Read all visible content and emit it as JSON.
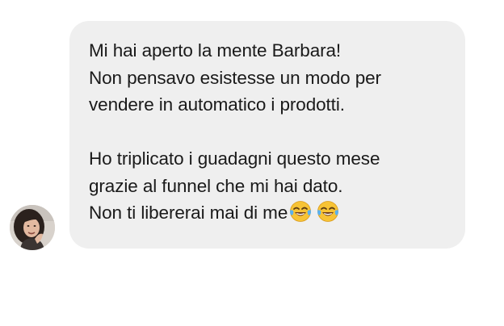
{
  "message": {
    "lines": [
      "Mi hai aperto la mente Barbara!",
      "Non pensavo esistesse un modo per",
      "vendere in automatico i prodotti.",
      "",
      "Ho triplicato i guadagni questo mese",
      "grazie al funnel che mi hai dato.",
      "Non ti libererai mai di me"
    ],
    "emojis": [
      "face-with-tears-of-joy-icon",
      "face-with-tears-of-joy-icon"
    ]
  },
  "colors": {
    "bubble_background": "#efefef",
    "text": "#1a1a1a",
    "page_background": "#ffffff"
  }
}
